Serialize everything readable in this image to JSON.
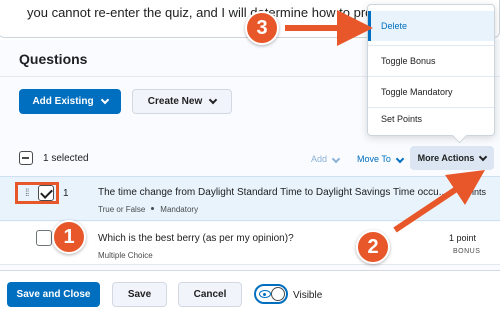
{
  "top_text": "you cannot re-enter the quiz, and I will determine how to proceed.",
  "section": {
    "title": "Questions"
  },
  "buttons": {
    "add_existing": "Add Existing",
    "create_new": "Create New"
  },
  "toolbar": {
    "selected": "1 selected",
    "add": "Add",
    "move_to": "Move To",
    "more_actions": "More Actions"
  },
  "menu": {
    "items": [
      "Delete",
      "Toggle Bonus",
      "Toggle Mandatory",
      "Set Points"
    ]
  },
  "questions": [
    {
      "number": "1",
      "title": "The time change from Daylight Standard Time to Daylight Savings Time occu...",
      "type": "True or False",
      "tag": "Mandatory",
      "points": "points",
      "selected": true
    },
    {
      "title": "Which is the best berry (as per my opinion)?",
      "type": "Multiple Choice",
      "points": "1 point",
      "badge": "BONUS",
      "selected": false
    }
  ],
  "footer": {
    "save_close": "Save and Close",
    "save": "Save",
    "cancel": "Cancel",
    "visible": "Visible"
  },
  "callouts": [
    "1",
    "2",
    "3"
  ],
  "colors": {
    "primary": "#006fbf",
    "annotation": "#e8572a",
    "selected_row": "#e8f3fc"
  }
}
